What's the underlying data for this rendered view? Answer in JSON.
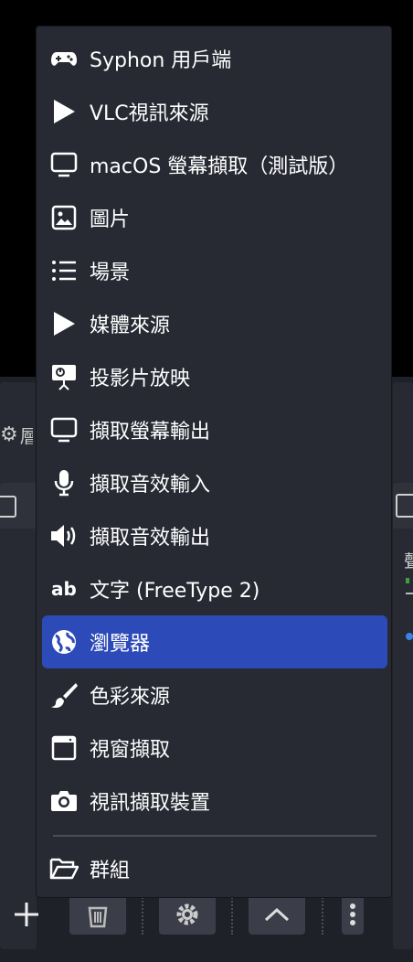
{
  "menu": {
    "items": [
      {
        "label": "Syphon 用戶端",
        "icon": "gamepad-icon"
      },
      {
        "label": "VLC視訊來源",
        "icon": "play-icon"
      },
      {
        "label": "macOS 螢幕擷取（測試版）",
        "icon": "monitor-icon"
      },
      {
        "label": "圖片",
        "icon": "image-icon"
      },
      {
        "label": "場景",
        "icon": "list-icon"
      },
      {
        "label": "媒體來源",
        "icon": "play-icon"
      },
      {
        "label": "投影片放映",
        "icon": "slideshow-icon"
      },
      {
        "label": "擷取螢幕輸出",
        "icon": "monitor-icon"
      },
      {
        "label": "擷取音效輸入",
        "icon": "microphone-icon"
      },
      {
        "label": "擷取音效輸出",
        "icon": "speaker-icon"
      },
      {
        "label": "文字 (FreeType 2)",
        "icon": "text-ab-icon"
      },
      {
        "label": "瀏覽器",
        "icon": "globe-icon",
        "selected": true
      },
      {
        "label": "色彩來源",
        "icon": "paintbrush-icon"
      },
      {
        "label": "視窗擷取",
        "icon": "window-icon"
      },
      {
        "label": "視訊擷取裝置",
        "icon": "camera-icon"
      }
    ],
    "group_item": {
      "label": "群組",
      "icon": "folder-open-icon"
    }
  },
  "background": {
    "scenes_dock_title_partial": "層",
    "mixer_partial": "聲"
  },
  "colors": {
    "menu_bg": "#272a33",
    "selected_bg": "#2c4ab8",
    "dock_bg": "#1f2129"
  }
}
